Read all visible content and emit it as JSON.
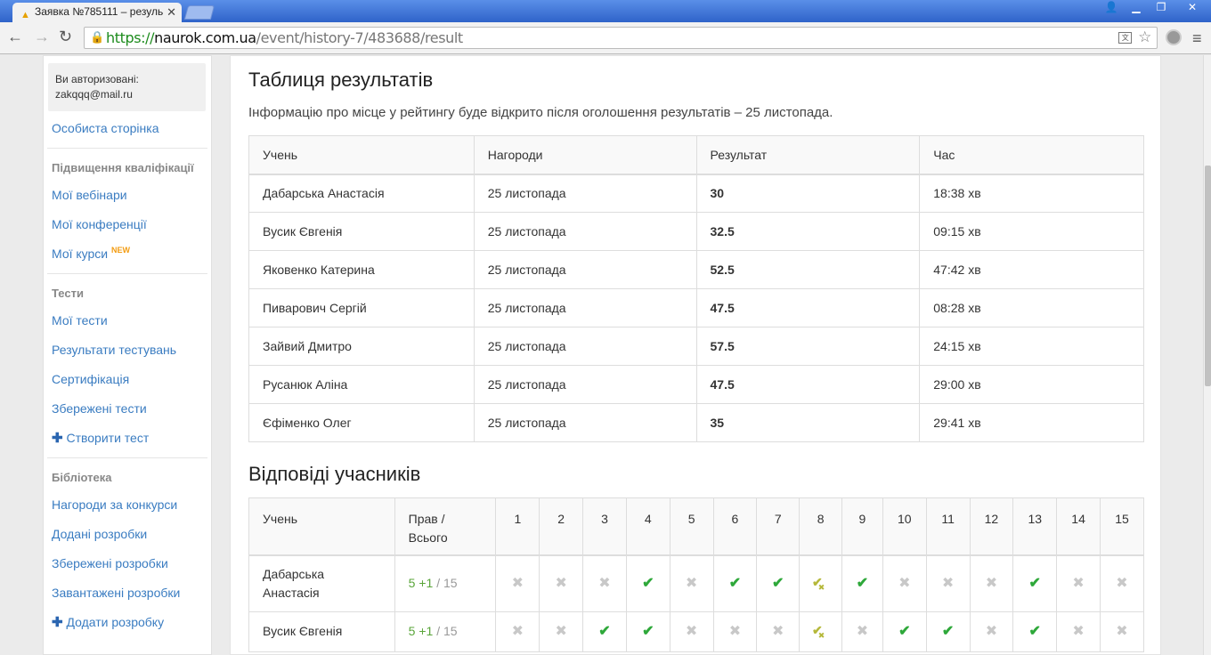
{
  "browser": {
    "tab_title": "Заявка №785111 – резуль",
    "url_scheme": "https://",
    "url_host": "naurok.com.ua",
    "url_path": "/event/history-7/483688/result"
  },
  "sidebar": {
    "auth_line1": "Ви авторизовані:",
    "auth_email": "zakqqq@mail.ru",
    "personal_page": "Особиста сторінка",
    "section_qualification": "Підвищення кваліфікації",
    "webinars": "Мої вебінари",
    "conferences": "Мої конференції",
    "courses": "Мої курси",
    "courses_badge": "NEW",
    "section_tests": "Тести",
    "my_tests": "Мої тести",
    "test_results": "Результати тестувань",
    "certification": "Сертифікація",
    "saved_tests": "Збережені тести",
    "create_test": "Створити тест",
    "section_library": "Бібліотека",
    "contest_awards": "Нагороди за конкурси",
    "added_works": "Додані розробки",
    "saved_works": "Збережені розробки",
    "downloaded_works": "Завантажені розробки",
    "add_work": "Додати розробку"
  },
  "results": {
    "title": "Таблиця результатів",
    "info": "Інформацію про місце у рейтингу буде відкрито після оголошення результатів – 25 листопада.",
    "columns": [
      "Учень",
      "Нагороди",
      "Результат",
      "Час"
    ],
    "rows": [
      {
        "name": "Дабарська Анастасія",
        "award": "25 листопада",
        "score": "30",
        "time": "18:38 хв"
      },
      {
        "name": "Вусик Євгенія",
        "award": "25 листопада",
        "score": "32.5",
        "time": "09:15 хв"
      },
      {
        "name": "Яковенко Катерина",
        "award": "25 листопада",
        "score": "52.5",
        "time": "47:42 хв"
      },
      {
        "name": "Пиварович Сергій",
        "award": "25 листопада",
        "score": "47.5",
        "time": "08:28 хв"
      },
      {
        "name": "Зайвий Дмитро",
        "award": "25 листопада",
        "score": "57.5",
        "time": "24:15 хв"
      },
      {
        "name": "Русанюк Аліна",
        "award": "25 листопада",
        "score": "47.5",
        "time": "29:00 хв"
      },
      {
        "name": "Єфіменко Олег",
        "award": "25 листопада",
        "score": "35",
        "time": "29:41 хв"
      }
    ]
  },
  "answers": {
    "title": "Відповіді учасників",
    "col_student": "Учень",
    "col_score_1": "Прав /",
    "col_score_2": "Всього",
    "questions": [
      "1",
      "2",
      "3",
      "4",
      "5",
      "6",
      "7",
      "8",
      "9",
      "10",
      "11",
      "12",
      "13",
      "14",
      "15"
    ],
    "rows": [
      {
        "name": "Дабарська Анастасія",
        "correct": "5",
        "bonus": "+1",
        "total": "/ 15",
        "marks": [
          "wrong",
          "wrong",
          "wrong",
          "correct",
          "wrong",
          "correct",
          "correct",
          "partial",
          "correct",
          "wrong",
          "wrong",
          "wrong",
          "correct",
          "wrong",
          "wrong"
        ]
      },
      {
        "name": "Вусик Євгенія",
        "correct": "5",
        "bonus": "+1",
        "total": "/ 15",
        "marks": [
          "wrong",
          "wrong",
          "correct",
          "correct",
          "wrong",
          "wrong",
          "wrong",
          "partial",
          "wrong",
          "correct",
          "correct",
          "wrong",
          "correct",
          "wrong",
          "wrong"
        ]
      }
    ]
  },
  "colors": {
    "link": "#3a7cc1",
    "correct": "#2ea83a",
    "wrong": "#c8c8c8",
    "partial": "#b5b83a",
    "badge": "#f39c12"
  }
}
